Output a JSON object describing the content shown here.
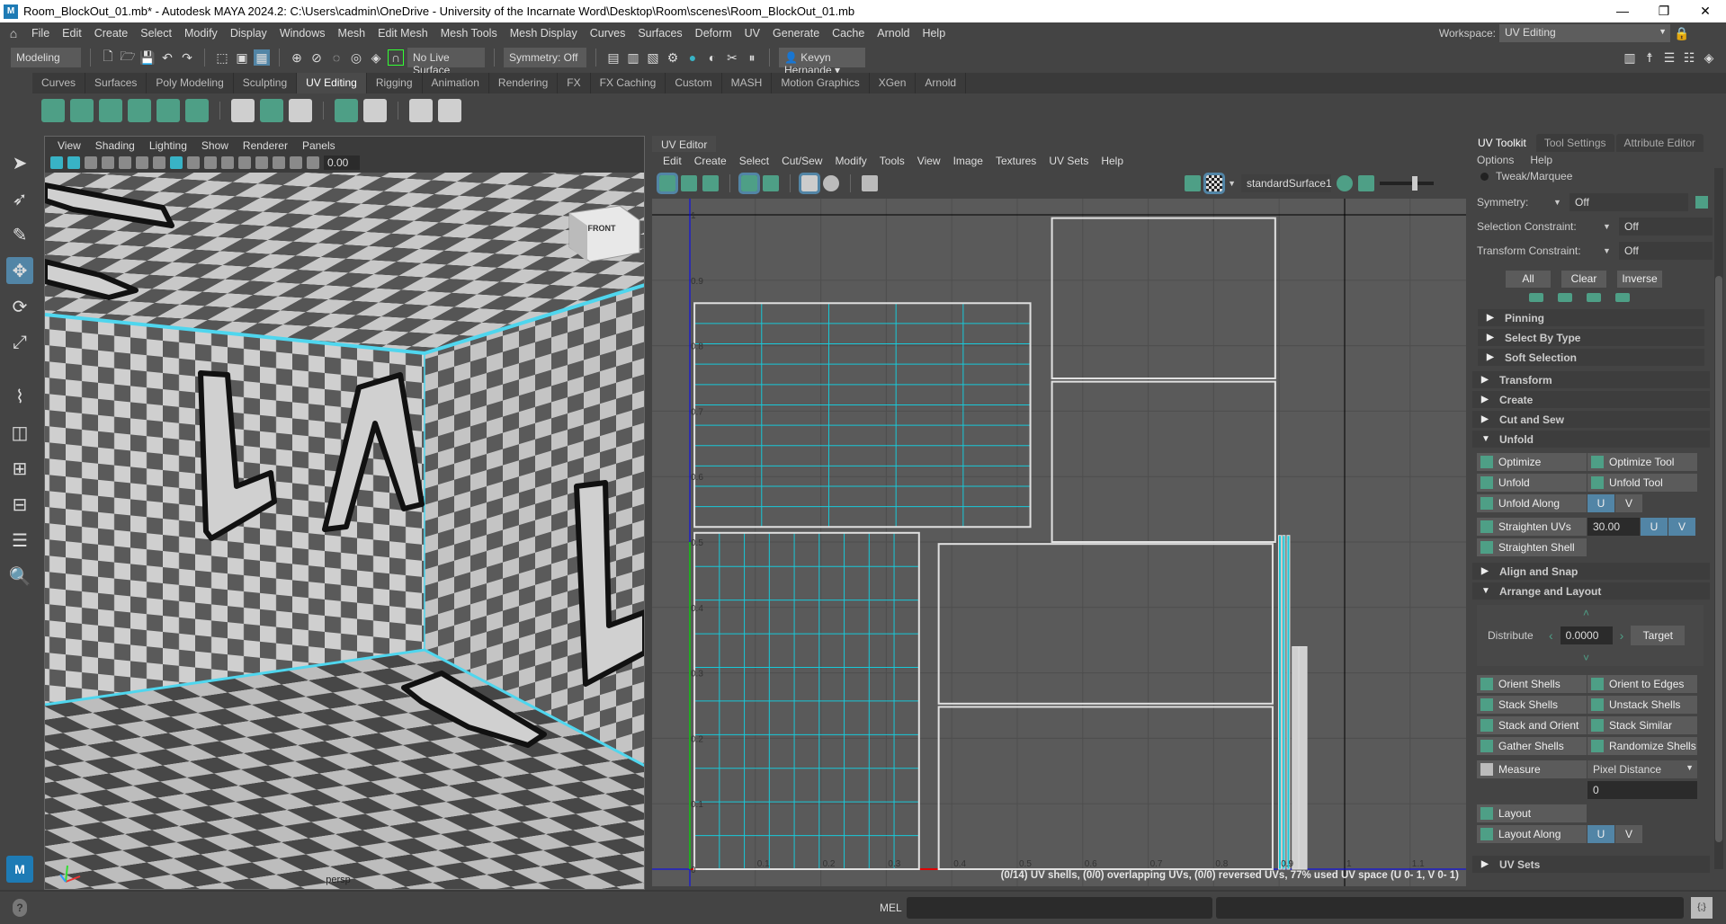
{
  "window": {
    "title": "Room_BlockOut_01.mb* - Autodesk MAYA 2024.2: C:\\Users\\cadmin\\OneDrive - University of the Incarnate Word\\Desktop\\Room\\scenes\\Room_BlockOut_01.mb",
    "logo": "M",
    "controls": [
      "—",
      "❐",
      "✕"
    ]
  },
  "menu": [
    "File",
    "Edit",
    "Create",
    "Select",
    "Modify",
    "Display",
    "Windows",
    "Mesh",
    "Edit Mesh",
    "Mesh Tools",
    "Mesh Display",
    "Curves",
    "Surfaces",
    "Deform",
    "UV",
    "Generate",
    "Cache",
    "Arnold",
    "Help"
  ],
  "workspace": {
    "label": "Workspace:",
    "value": "UV Editing"
  },
  "statusline": {
    "mode": "Modeling",
    "live_surface": "No Live Surface",
    "symmetry": "Symmetry: Off",
    "user": "Kevyn Hernande"
  },
  "shelf": {
    "tabs": [
      "Curves",
      "Surfaces",
      "Poly Modeling",
      "Sculpting",
      "UV Editing",
      "Rigging",
      "Animation",
      "Rendering",
      "FX",
      "FX Caching",
      "Custom",
      "MASH",
      "Motion Graphics",
      "XGen",
      "Arnold"
    ],
    "active": "UV Editing"
  },
  "viewport": {
    "menu": [
      "View",
      "Shading",
      "Lighting",
      "Show",
      "Renderer",
      "Panels"
    ],
    "exposure": "0.00",
    "camera": "persp",
    "viewcube": "FRONT"
  },
  "uv_editor": {
    "tab": "UV Editor",
    "menu": [
      "Edit",
      "Create",
      "Select",
      "Cut/Sew",
      "Modify",
      "Tools",
      "View",
      "Image",
      "Textures",
      "UV Sets",
      "Help"
    ],
    "material": "standardSurface1",
    "u_ticks": [
      "0.1",
      "0.2",
      "0.3",
      "0.4",
      "0.5",
      "0.6",
      "0.7",
      "0.8",
      "0.9",
      "1",
      "1.1"
    ],
    "v_ticks": [
      "0",
      "0.1",
      "0.2",
      "0.3",
      "0.4",
      "0.5",
      "0.6",
      "0.7",
      "0.8",
      "0.9",
      "1"
    ],
    "status": "(0/14) UV shells, (0/0) overlapping UVs, (0/0) reversed UVs, 77% used UV space (U  0- 1, V  0- 1)"
  },
  "toolkit": {
    "tabs": [
      "UV Toolkit",
      "Tool Settings",
      "Attribute Editor"
    ],
    "menu": [
      "Options",
      "Help"
    ],
    "tweak": "Tweak/Marquee",
    "symmetry": {
      "label": "Symmetry:",
      "value": "Off"
    },
    "selection_constraint": {
      "label": "Selection Constraint:",
      "value": "Off"
    },
    "transform_constraint": {
      "label": "Transform Constraint:",
      "value": "Off"
    },
    "buttons": [
      "All",
      "Clear",
      "Inverse"
    ],
    "sub_sections": [
      "Pinning",
      "Select By Type",
      "Soft Selection"
    ],
    "sections": [
      "Transform",
      "Create",
      "Cut and Sew"
    ],
    "unfold": {
      "title": "Unfold",
      "optimize": "Optimize",
      "optimize_tool": "Optimize Tool",
      "unfold": "Unfold",
      "unfold_tool": "Unfold Tool",
      "unfold_along": "Unfold Along",
      "straighten_uvs": "Straighten UVs",
      "straighten_value": "30.00",
      "straighten_shell": "Straighten Shell",
      "u": "U",
      "v": "V"
    },
    "align": "Align and Snap",
    "arrange": {
      "title": "Arrange and Layout",
      "distribute": "Distribute",
      "distribute_value": "0.0000",
      "target": "Target",
      "tools": [
        [
          "Orient Shells",
          "Orient to Edges"
        ],
        [
          "Stack Shells",
          "Unstack Shells"
        ],
        [
          "Stack and Orient",
          "Stack Similar"
        ],
        [
          "Gather Shells",
          "Randomize Shells"
        ]
      ],
      "measure": "Measure",
      "measure_mode": "Pixel Distance",
      "measure_value": "0",
      "layout": "Layout",
      "layout_along": "Layout Along"
    },
    "uv_sets": "UV Sets"
  },
  "commandline": {
    "label": "MEL",
    "help": "?"
  },
  "colors": {
    "accent": "#5285a6",
    "icon_green": "#4e9f86",
    "uv_edge": "#18c8d8",
    "uv_border": "#e0e0e0",
    "u_axis": "#e00000",
    "v_axis": "#0000ff"
  }
}
